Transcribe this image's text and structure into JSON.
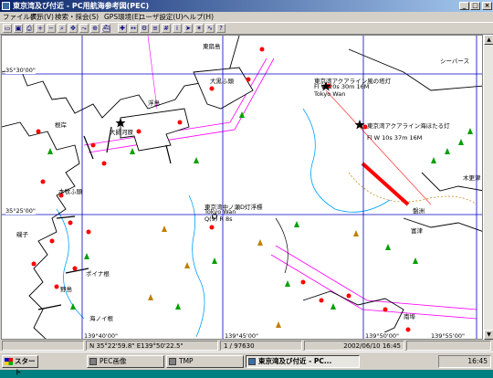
{
  "window": {
    "title": "東京湾及び付近 - PC用航海参考図(PEC)"
  },
  "menu": [
    "ファイル(F)",
    "表示(V)",
    "検索・採会(S)",
    "GPS環境(E)",
    "ユーザ設定(U)",
    "ヘルプ(H)"
  ],
  "toolbar_icons": [
    "open-icon",
    "save-icon",
    "print-icon",
    "zoom-in-icon",
    "zoom-out-icon",
    "search-icon",
    "pan-icon",
    "route-icon",
    "gps-icon",
    "ship-icon",
    "mark-icon",
    "measure-icon",
    "settings-icon",
    "layer-icon",
    "grid-icon",
    "info-icon",
    "nav-icon",
    "light-icon",
    "depth-icon",
    "help-icon"
  ],
  "map": {
    "latitudes": [
      "35°30'00\"",
      "35°25'00\""
    ],
    "longitudes": [
      "139°40'00\"",
      "139°45'00\"",
      "139°50'00\"",
      "139°55'00\""
    ],
    "labels": {
      "tower_north": "東京湾アクアライン風の塔灯",
      "tower_north_sub": "Fl W 20s 30m 16M",
      "tower_south": "東京湾アクアライン海ほたる灯",
      "tower_south_sub": "Fl W 10s 37m 16M",
      "buoy_name": "東京湾中ノ瀬D灯浮標",
      "buoy_en": "Tokyo Wan",
      "buoy_sub": "Q(9) R 8s",
      "bay_en": "Tokyo Wan",
      "place_daishi": "大師河原",
      "place_honmoku": "本牧ふ頭",
      "place_dai": "大黒ふ頭",
      "place_negishi": "根岸",
      "place_isogo": "磯子",
      "place_kanazawa": "ポイナ根",
      "place_hakkeijima": "海ノイ根",
      "place_ukishima": "浮島",
      "place_kisarazu": "木更津",
      "place_hamaguri": "盤洲",
      "place_haneda": "東扇島",
      "place_noji": "野島",
      "place_south": "南埠",
      "place_sheeba": "シーバース",
      "place_futtsu": "富津"
    }
  },
  "status": {
    "position": "N 35°22'59.8\" E139°50'22.5\"",
    "scale": "1 / 97630",
    "datetime": "2002/06/10 16:45"
  },
  "taskbar": {
    "start": "スタート",
    "tasks": [
      "PEC画像",
      "TMP",
      "東京湾及び付近 - PC..."
    ],
    "clock": "16:45"
  },
  "colors": {
    "grid": "#0000c0",
    "land": "#000000",
    "light": "#ff0000",
    "green_buoy": "#00a000",
    "route": "#ff00ff",
    "depth": "#00a0ff"
  }
}
